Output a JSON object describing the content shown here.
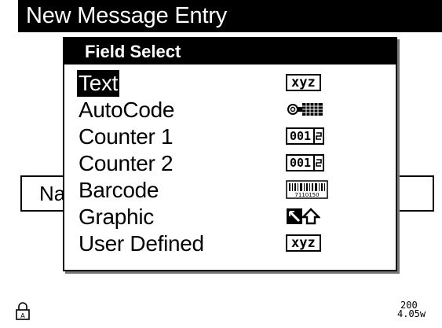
{
  "window": {
    "title": "New Message Entry"
  },
  "background_field": {
    "label_fragment": "Nai"
  },
  "dialog": {
    "title": "Field Select",
    "items": [
      {
        "label": "Text",
        "icon": "xyz-box-icon",
        "icon_text": "xyz",
        "selected": true
      },
      {
        "label": "AutoCode",
        "icon": "autocode-icon",
        "selected": false
      },
      {
        "label": "Counter 1",
        "icon": "counter-icon",
        "icon_text": "001",
        "selected": false
      },
      {
        "label": "Counter 2",
        "icon": "counter-icon",
        "icon_text": "001",
        "selected": false
      },
      {
        "label": "Barcode",
        "icon": "barcode-icon",
        "icon_text": "7110150",
        "selected": false
      },
      {
        "label": "Graphic",
        "icon": "graphic-icon",
        "selected": false
      },
      {
        "label": "User Defined",
        "icon": "xyz-box-icon",
        "icon_text": "xyz",
        "selected": false
      }
    ]
  },
  "status": {
    "lock_icon": "lock-icon",
    "lock_text": "A",
    "value_top": "200",
    "value_bottom": "4.05w"
  }
}
